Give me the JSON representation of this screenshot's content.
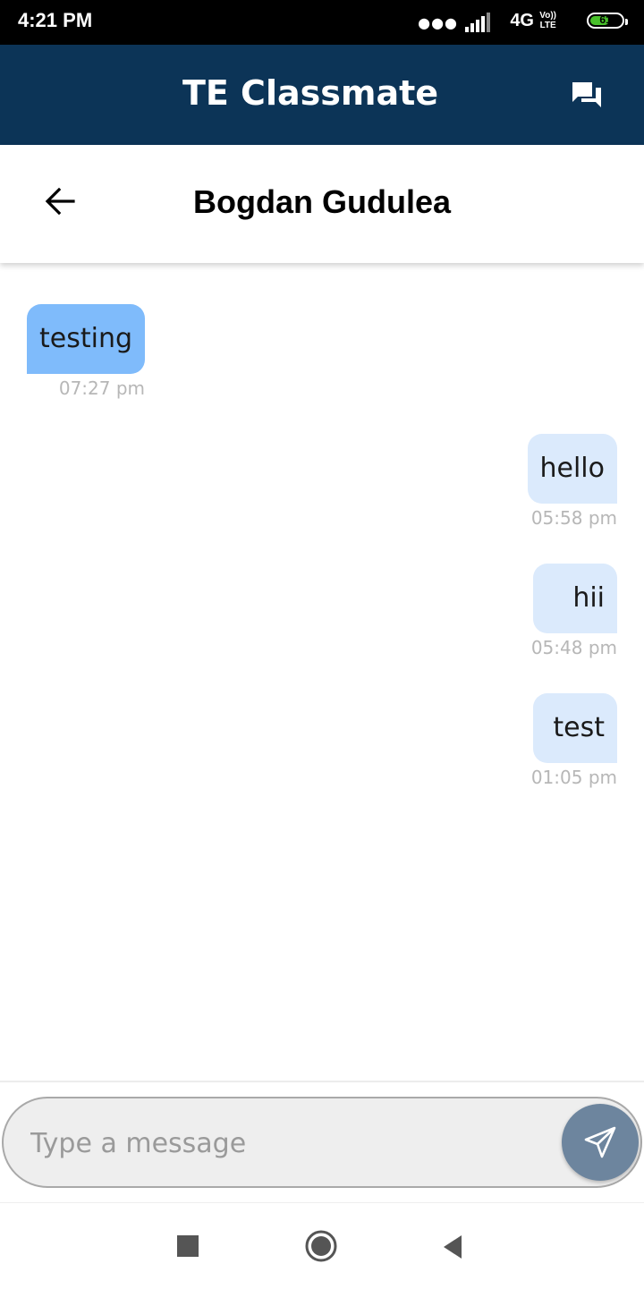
{
  "status_bar": {
    "time": "4:21 PM",
    "network": "4G",
    "volte_line1": "Vo))",
    "volte_line2": "LTE",
    "battery": "61",
    "battery_level": 0.61
  },
  "app_bar": {
    "title": "TE Classmate",
    "chat_icon": "chat-bubbles-icon"
  },
  "chat_header": {
    "back_icon": "arrow-left-icon",
    "contact_name": "Bogdan Gudulea"
  },
  "messages": [
    {
      "text": "testing",
      "time": "07:27 pm",
      "direction": "incoming"
    },
    {
      "text": "hello",
      "time": "05:58 pm",
      "direction": "outgoing"
    },
    {
      "text": "hii",
      "time": "05:48 pm",
      "direction": "outgoing"
    },
    {
      "text": "test",
      "time": "01:05 pm",
      "direction": "outgoing"
    }
  ],
  "composer": {
    "placeholder": "Type a message",
    "send_icon": "send-icon"
  },
  "nav_bar": {
    "recents_icon": "square-icon",
    "home_icon": "circle-icon",
    "back_icon": "triangle-back-icon"
  },
  "colors": {
    "app_bar": "#0c3457",
    "incoming_bubble": "#7fbbfb",
    "outgoing_bubble": "#dbeafc",
    "send_button": "#6d859e"
  }
}
